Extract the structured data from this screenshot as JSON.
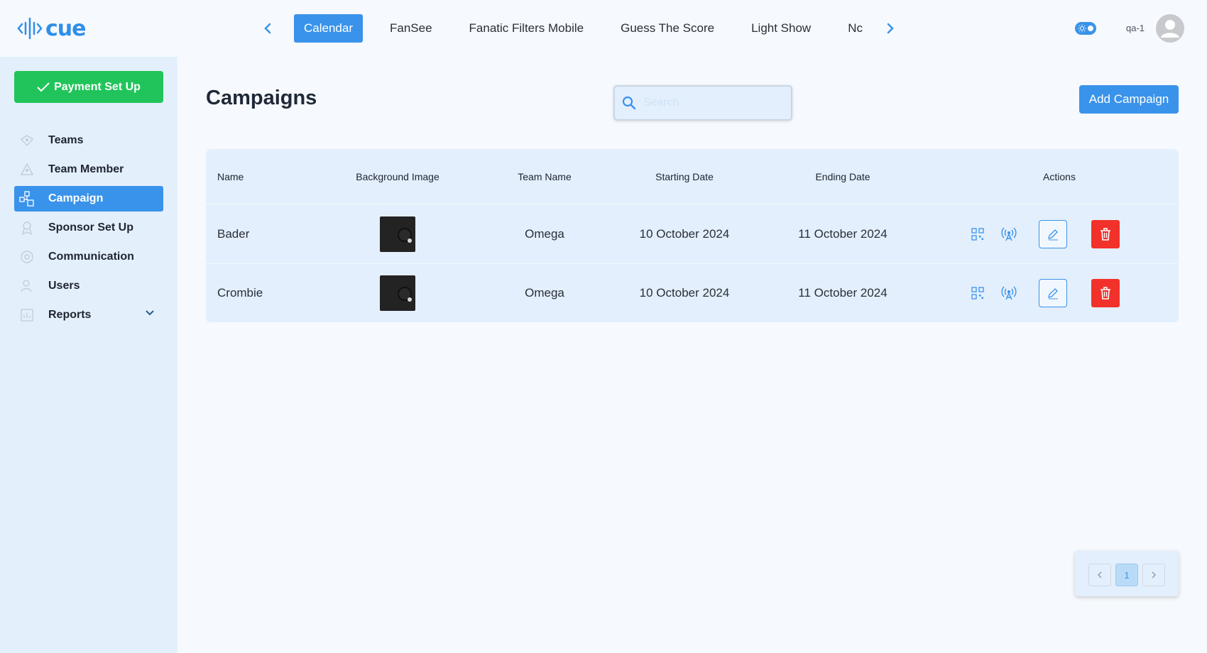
{
  "app": {
    "logo_text": "cue",
    "username": "qa-1"
  },
  "colors": {
    "accent": "#3a93ea",
    "success": "#21c45a",
    "danger": "#f2312a",
    "sidebar_bg": "#e3f0fc"
  },
  "top_tabs": [
    {
      "label": "Calendar",
      "active": true
    },
    {
      "label": "FanSee",
      "active": false
    },
    {
      "label": "Fanatic Filters Mobile",
      "active": false
    },
    {
      "label": "Guess The Score",
      "active": false
    },
    {
      "label": "Light Show",
      "active": false
    },
    {
      "label": "Nc",
      "active": false
    }
  ],
  "sidebar": {
    "payment_button": "Payment Set Up",
    "items": [
      {
        "label": "Teams",
        "icon": "teams-icon",
        "active": false
      },
      {
        "label": "Team Member",
        "icon": "team-member-icon",
        "active": false
      },
      {
        "label": "Campaign",
        "icon": "campaign-icon",
        "active": true
      },
      {
        "label": "Sponsor Set Up",
        "icon": "sponsor-icon",
        "active": false
      },
      {
        "label": "Communication",
        "icon": "communication-icon",
        "active": false
      },
      {
        "label": "Users",
        "icon": "users-icon",
        "active": false
      },
      {
        "label": "Reports",
        "icon": "reports-icon",
        "active": false,
        "expandable": true
      }
    ]
  },
  "main": {
    "title": "Campaigns",
    "search_placeholder": "Search",
    "add_button": "Add Campaign"
  },
  "table": {
    "headers": [
      "Name",
      "Background Image",
      "Team Name",
      "Starting Date",
      "Ending Date",
      "Actions"
    ],
    "rows": [
      {
        "name": "Bader",
        "team": "Omega",
        "start": "10 October 2024",
        "end": "11 October 2024"
      },
      {
        "name": "Crombie",
        "team": "Omega",
        "start": "10 October 2024",
        "end": "11 October 2024"
      }
    ]
  },
  "pagination": {
    "current_page": "1"
  }
}
